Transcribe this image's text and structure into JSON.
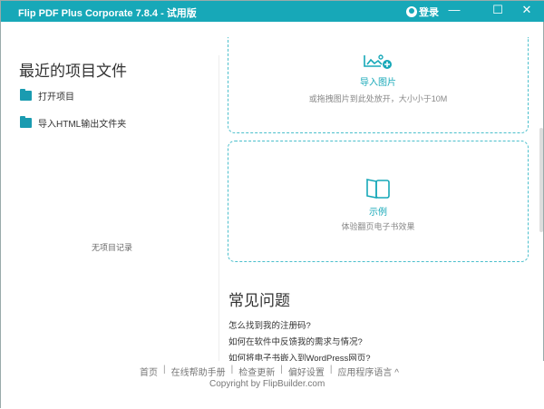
{
  "window": {
    "title": "Flip PDF Plus Corporate 7.8.4 - 试用版",
    "login": "登录",
    "minimize": "—",
    "maximize": "☐",
    "close": "✕"
  },
  "left": {
    "title": "最近的项目文件",
    "items": [
      {
        "label": "打开项目"
      },
      {
        "label": "导入HTML输出文件夹"
      }
    ],
    "empty": "无项目记录"
  },
  "import": {
    "label": "导入图片",
    "sub": "或拖拽图片到此处放开，大小小于10M"
  },
  "sample": {
    "label": "示例",
    "sub": "体验翻页电子书效果"
  },
  "faq": {
    "title": "常见问题",
    "items": [
      "怎么找到我的注册码?",
      "如何在软件中反馈我的需求与情况?",
      "如何将电子书嵌入到WordPress网页?"
    ]
  },
  "footer": {
    "links": [
      "首页",
      "在线帮助手册",
      "检查更新",
      "偏好设置",
      "应用程序语言 ^"
    ],
    "copyright": "Copyright by FlipBuilder.com"
  }
}
